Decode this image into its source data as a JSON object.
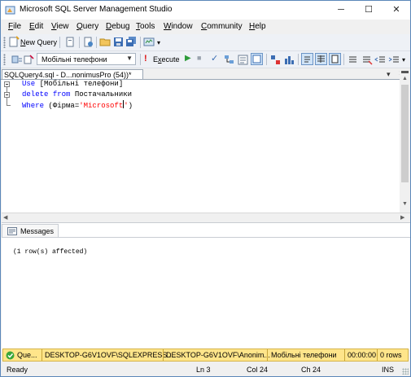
{
  "window": {
    "title": "Microsoft SQL Server Management Studio",
    "controls": [
      "─",
      "☐",
      "✕"
    ]
  },
  "menu": {
    "items": [
      {
        "u": "F",
        "rest": "ile"
      },
      {
        "u": "E",
        "rest": "dit"
      },
      {
        "u": "V",
        "rest": "iew"
      },
      {
        "u": "Q",
        "rest": "uery"
      },
      {
        "u": "D",
        "rest": "ebug"
      },
      {
        "u": "T",
        "rest": "ools"
      },
      {
        "u": "W",
        "rest": "indow"
      },
      {
        "u": "C",
        "rest": "ommunity"
      },
      {
        "u": "H",
        "rest": "elp"
      }
    ]
  },
  "toolbar1": {
    "new_query_u": "N",
    "new_query_rest": "ew Query"
  },
  "toolbar2": {
    "database": "Мобільні телефони",
    "execute_u": "x",
    "execute_pre": "E",
    "execute_post": "ecute"
  },
  "tab": {
    "title": "SQLQuery4.sql - D...nonimusPro (54))*",
    "close": "×",
    "pin": "▾"
  },
  "editor": {
    "line1": {
      "kw": "Use",
      "plain": " [Мобільні телефони]"
    },
    "line2": {
      "kw1": "delete",
      "kw2": "from",
      "plain": " Постачальники"
    },
    "line3": {
      "kw": "Where",
      "paren_open": " (Фірма=",
      "str_a": "'Microsoft",
      "str_b": "'",
      "paren_close": ")"
    }
  },
  "results": {
    "tab_label": "Messages",
    "message": "(1 row(s) affected)"
  },
  "query_status": {
    "status": "Que...",
    "server": "DESKTOP-G6V1OVF\\SQLEXPRESS ...",
    "user": "DESKTOP-G6V1OVF\\Anonim...",
    "database": "Мобільні телефони",
    "time": "00:00:00",
    "rows": "0 rows"
  },
  "statusbar": {
    "state": "Ready",
    "ln": "Ln 3",
    "col": "Col 24",
    "ch": "Ch 24",
    "mode": "INS"
  },
  "colors": {
    "keyword": "#0000ff",
    "string": "#ff0000",
    "status_bar": "#ffe58a"
  }
}
